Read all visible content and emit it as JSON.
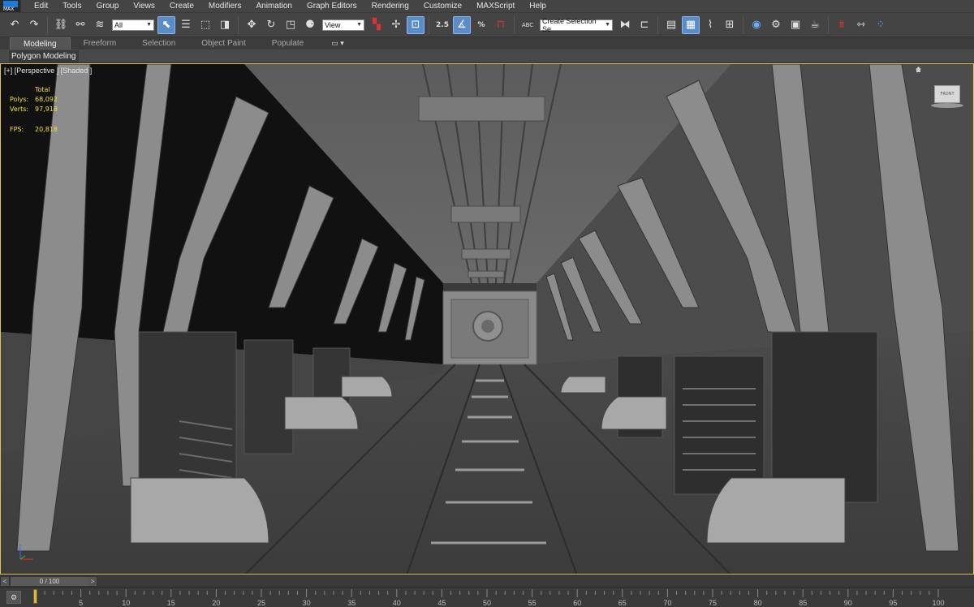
{
  "app": {
    "logo_text": "MAX"
  },
  "menu": [
    "Edit",
    "Tools",
    "Group",
    "Views",
    "Create",
    "Modifiers",
    "Animation",
    "Graph Editors",
    "Rendering",
    "Customize",
    "MAXScript",
    "Help"
  ],
  "toolbar": {
    "selection_filter": "All",
    "reference_coord": "View",
    "snap_toggle_label": "2.5",
    "percent_snap_label": "%",
    "named_selection": "Create Selection Se",
    "abc_label": "ABC"
  },
  "ribbon": {
    "tabs": [
      "Modeling",
      "Freeform",
      "Selection",
      "Object Paint",
      "Populate"
    ],
    "active_tab": "Modeling",
    "panel_label": "Polygon Modeling"
  },
  "viewport": {
    "label": "[+] [Perspective ] [Shaded ]",
    "stats": {
      "header": "Total",
      "polys_label": "Polys:",
      "polys_value": "68,092",
      "verts_label": "Verts:",
      "verts_value": "97,918",
      "fps_label": "FPS:",
      "fps_value": "20,818"
    },
    "viewcube_face": "FRONT"
  },
  "timeline": {
    "frame_display": "0 / 100",
    "prev": "<",
    "next": ">",
    "ticks": [
      5,
      10,
      15,
      20,
      25,
      30,
      35,
      40,
      45,
      50,
      55,
      60,
      65,
      70,
      75,
      80,
      85,
      90,
      95,
      100
    ],
    "start": 0,
    "end": 100,
    "current": 0
  },
  "colors": {
    "accent": "#5a8dc8",
    "viewport_border": "#e0c060",
    "stats_text": "#f0e040"
  }
}
